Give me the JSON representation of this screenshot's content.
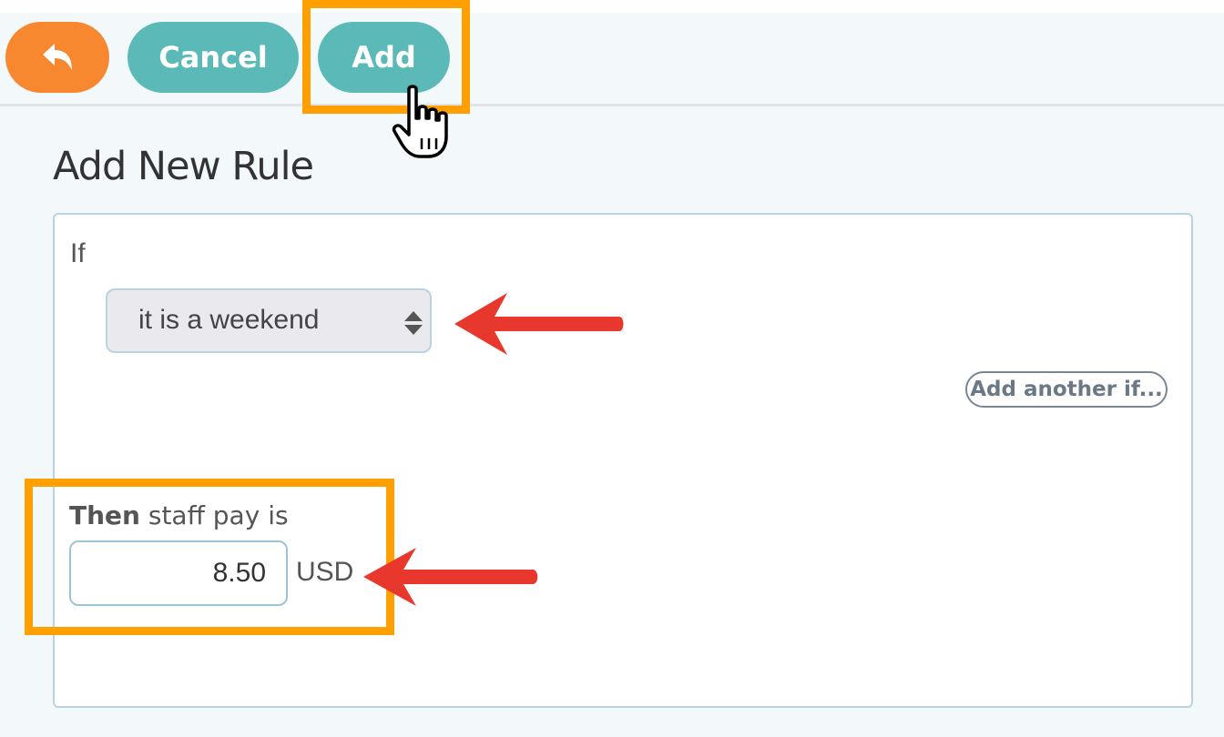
{
  "toolbar": {
    "back_icon": "undo-arrow-icon",
    "cancel_label": "Cancel",
    "add_label": "Add"
  },
  "page": {
    "title": "Add New Rule"
  },
  "rule": {
    "if_label": "If",
    "condition_value": "it is a weekend",
    "add_another_label": "Add another if...",
    "then_bold": "Then",
    "then_rest": " staff pay is",
    "pay_value": "8.50",
    "currency": "USD"
  },
  "colors": {
    "back_button": "#f7882f",
    "primary_button": "#5bbab8",
    "highlight": "#ffa000",
    "annotation_arrow": "#e8372c"
  }
}
